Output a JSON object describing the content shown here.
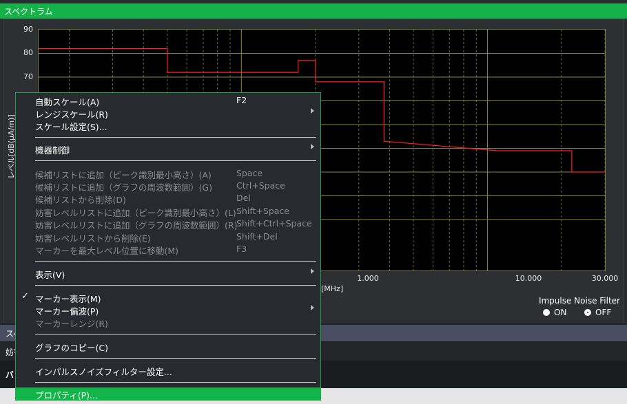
{
  "window": {
    "title": "スペクトラム"
  },
  "chart_data": {
    "type": "line",
    "ylabel": "レベル[dB(μA/m)]",
    "xunit": "[MHz]",
    "ylim": [
      0,
      90
    ],
    "xlim": [
      0.15,
      30
    ],
    "x_scale": "log",
    "yticks": [
      "90",
      "80",
      "70"
    ],
    "xticks": [
      "1.000",
      "10.000",
      "30.000"
    ],
    "grid": true,
    "series": [
      {
        "color": "#ff1f1f",
        "x": [
          0.15,
          0.5,
          0.5,
          1.7,
          1.7,
          2.0,
          2.0,
          3.8,
          3.8,
          11.0,
          22.0,
          22.0,
          30.0
        ],
        "y": [
          82,
          82,
          72,
          72,
          77,
          77,
          68,
          68,
          43,
          39,
          39,
          30,
          30
        ]
      }
    ]
  },
  "ipnf": {
    "title": "Impulse Noise Filter",
    "on": "ON",
    "off": "OFF",
    "selected": "OFF"
  },
  "background_rows": {
    "bar2": "スペ",
    "row3": "妨害",
    "row4": "バン"
  },
  "menu": {
    "items": [
      {
        "label": "自動スケール(A)",
        "shortcut": "F2"
      },
      {
        "label": "レンジスケール(R)"
      },
      {
        "label": "スケール設定(S)..."
      },
      {
        "label": "機器制御"
      },
      {
        "label": "候補リストに追加（ピーク識別最小高さ）(A)",
        "shortcut": "Space"
      },
      {
        "label": "候補リストに追加（グラフの周波数範囲）(G)",
        "shortcut": "Ctrl+Space"
      },
      {
        "label": "候補リストから削除(D)",
        "shortcut": "Del"
      },
      {
        "label": "妨害レベルリストに追加（ピーク識別最小高さ）(L)",
        "shortcut": "Shift+Space"
      },
      {
        "label": "妨害レベルリストに追加（グラフの周波数範囲）(R)",
        "shortcut": "Shift+Ctrl+Space"
      },
      {
        "label": "妨害レベルリストから削除(E)",
        "shortcut": "Shift+Del"
      },
      {
        "label": "マーカーを最大レベル位置に移動(M)",
        "shortcut": "F3"
      },
      {
        "label": "表示(V)"
      },
      {
        "label": "マーカー表示(M)",
        "check": "✓"
      },
      {
        "label": "マーカー偏波(P)"
      },
      {
        "label": "マーカーレンジ(R)"
      },
      {
        "label": "グラフのコピー(C)"
      },
      {
        "label": "インパルスノイズフィルター設定..."
      },
      {
        "label": "プロパティ(P)..."
      }
    ]
  },
  "colors": {
    "accent": "#15b24a",
    "grid": "#8a8a2a",
    "trace": "#ff1f1f"
  }
}
